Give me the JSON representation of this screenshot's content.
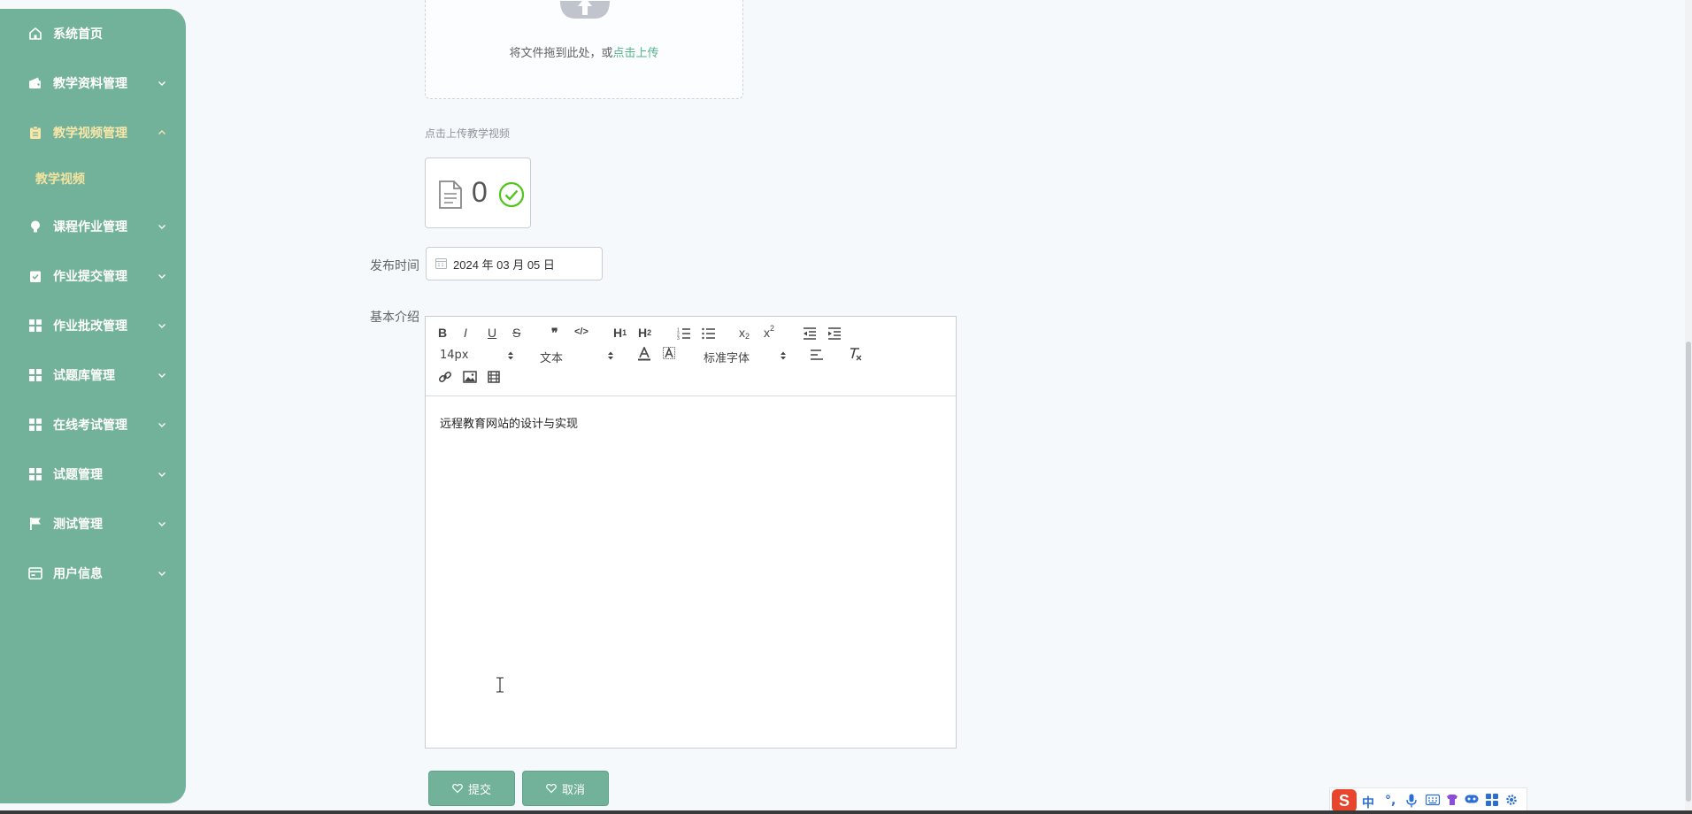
{
  "sidebar": {
    "items": [
      {
        "label": "系统首页",
        "icon": "home-icon",
        "active": false,
        "expandable": false
      },
      {
        "label": "教学资料管理",
        "icon": "wallet-icon",
        "active": false,
        "expandable": true,
        "expanded": false
      },
      {
        "label": "教学视频管理",
        "icon": "clipboard-icon",
        "active": true,
        "expandable": true,
        "expanded": true
      },
      {
        "label": "课程作业管理",
        "icon": "bulb-icon",
        "active": false,
        "expandable": true,
        "expanded": false
      },
      {
        "label": "作业提交管理",
        "icon": "clipboard-check-icon",
        "active": false,
        "expandable": true,
        "expanded": false
      },
      {
        "label": "作业批改管理",
        "icon": "grid-icon",
        "active": false,
        "expandable": true,
        "expanded": false
      },
      {
        "label": "试题库管理",
        "icon": "grid-icon",
        "active": false,
        "expandable": true,
        "expanded": false
      },
      {
        "label": "在线考试管理",
        "icon": "grid-icon",
        "active": false,
        "expandable": true,
        "expanded": false
      },
      {
        "label": "试题管理",
        "icon": "grid-icon",
        "active": false,
        "expandable": true,
        "expanded": false
      },
      {
        "label": "测试管理",
        "icon": "flag-icon",
        "active": false,
        "expandable": true,
        "expanded": false
      },
      {
        "label": "用户信息",
        "icon": "card-icon",
        "active": false,
        "expandable": true,
        "expanded": false
      }
    ],
    "sub_item": {
      "label": "教学视频"
    }
  },
  "upload": {
    "text": "将文件拖到此处，或",
    "link": "点击上传",
    "hint": "点击上传教学视频"
  },
  "file_card": {
    "count": "0"
  },
  "form": {
    "publish_time_label": "发布时间",
    "publish_time_value": "2024 年 03 月 05 日",
    "intro_label": "基本介绍"
  },
  "editor": {
    "font_size": "14px",
    "header_picker": "文本",
    "font_family": "标准字体",
    "content": "远程教育网站的设计与实现"
  },
  "buttons": {
    "submit": "提交",
    "cancel": "取消"
  },
  "ime": {
    "mode": "中",
    "logo": "S"
  },
  "colors": {
    "sidebar": "#72b29a",
    "active_label": "#f7e6a8",
    "link": "#52b58a",
    "button": "#72b29a",
    "success": "#52c41a"
  }
}
